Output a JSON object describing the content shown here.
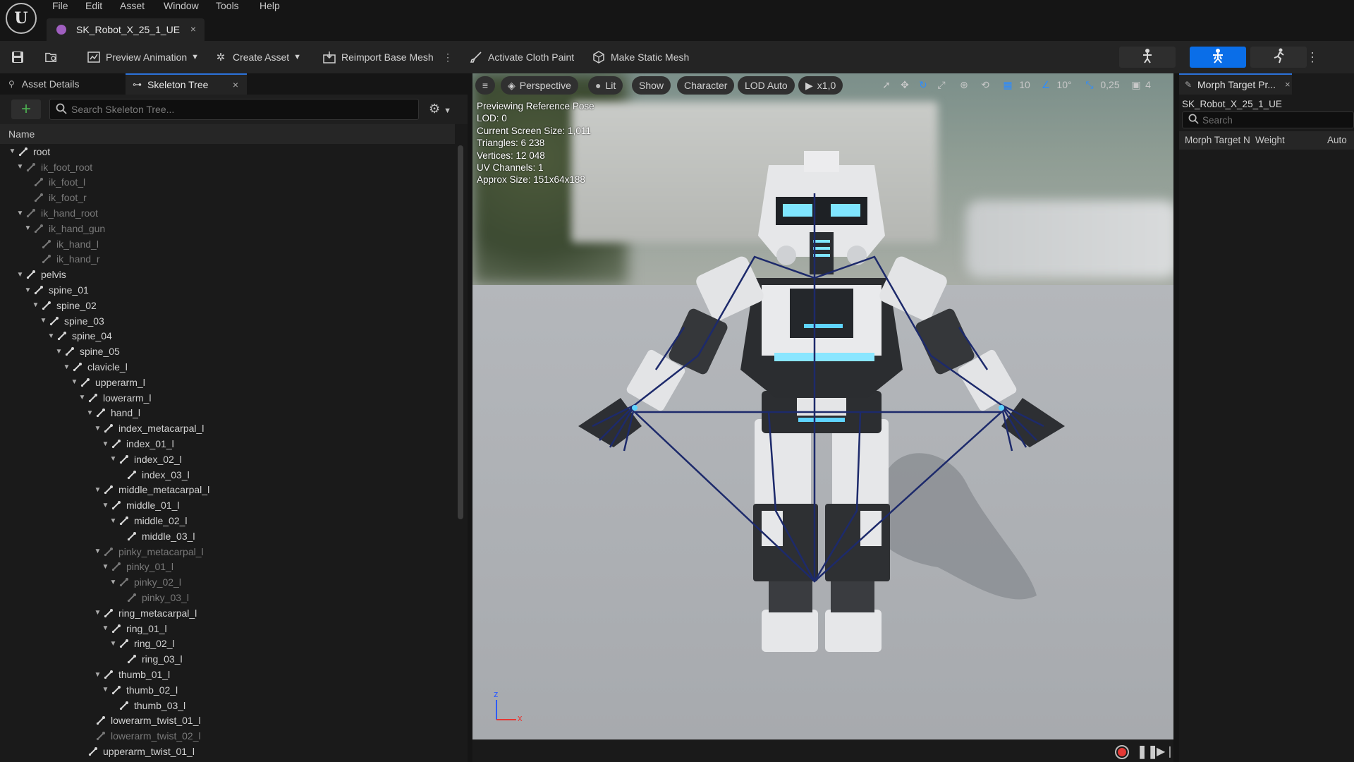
{
  "menu": {
    "items": [
      "File",
      "Edit",
      "Asset",
      "Window",
      "Tools",
      "Help"
    ]
  },
  "document_tab": {
    "title": "SK_Robot_X_25_1_UE",
    "close": "×"
  },
  "toolbar": {
    "preview_animation": "Preview Animation",
    "create_asset": "Create Asset",
    "reimport_base_mesh": "Reimport Base Mesh",
    "activate_cloth_paint": "Activate Cloth Paint",
    "make_static_mesh": "Make Static Mesh"
  },
  "left_panel": {
    "tabs": {
      "asset_details": "Asset Details",
      "skeleton_tree": "Skeleton Tree",
      "close": "×"
    },
    "search_placeholder": "Search Skeleton Tree...",
    "column_header": "Name",
    "bones": [
      {
        "name": "root",
        "depth": 0,
        "dim": false,
        "expanded": true
      },
      {
        "name": "ik_foot_root",
        "depth": 1,
        "dim": true,
        "expanded": true
      },
      {
        "name": "ik_foot_l",
        "depth": 2,
        "dim": true,
        "expanded": null
      },
      {
        "name": "ik_foot_r",
        "depth": 2,
        "dim": true,
        "expanded": null
      },
      {
        "name": "ik_hand_root",
        "depth": 1,
        "dim": true,
        "expanded": true
      },
      {
        "name": "ik_hand_gun",
        "depth": 2,
        "dim": true,
        "expanded": true
      },
      {
        "name": "ik_hand_l",
        "depth": 3,
        "dim": true,
        "expanded": null
      },
      {
        "name": "ik_hand_r",
        "depth": 3,
        "dim": true,
        "expanded": null
      },
      {
        "name": "pelvis",
        "depth": 1,
        "dim": false,
        "expanded": true
      },
      {
        "name": "spine_01",
        "depth": 2,
        "dim": false,
        "expanded": true
      },
      {
        "name": "spine_02",
        "depth": 3,
        "dim": false,
        "expanded": true
      },
      {
        "name": "spine_03",
        "depth": 4,
        "dim": false,
        "expanded": true
      },
      {
        "name": "spine_04",
        "depth": 5,
        "dim": false,
        "expanded": true
      },
      {
        "name": "spine_05",
        "depth": 6,
        "dim": false,
        "expanded": true
      },
      {
        "name": "clavicle_l",
        "depth": 7,
        "dim": false,
        "expanded": true
      },
      {
        "name": "upperarm_l",
        "depth": 8,
        "dim": false,
        "expanded": true
      },
      {
        "name": "lowerarm_l",
        "depth": 9,
        "dim": false,
        "expanded": true
      },
      {
        "name": "hand_l",
        "depth": 10,
        "dim": false,
        "expanded": true
      },
      {
        "name": "index_metacarpal_l",
        "depth": 11,
        "dim": false,
        "expanded": true
      },
      {
        "name": "index_01_l",
        "depth": 12,
        "dim": false,
        "expanded": true
      },
      {
        "name": "index_02_l",
        "depth": 13,
        "dim": false,
        "expanded": true
      },
      {
        "name": "index_03_l",
        "depth": 14,
        "dim": false,
        "expanded": null
      },
      {
        "name": "middle_metacarpal_l",
        "depth": 11,
        "dim": false,
        "expanded": true
      },
      {
        "name": "middle_01_l",
        "depth": 12,
        "dim": false,
        "expanded": true
      },
      {
        "name": "middle_02_l",
        "depth": 13,
        "dim": false,
        "expanded": true
      },
      {
        "name": "middle_03_l",
        "depth": 14,
        "dim": false,
        "expanded": null
      },
      {
        "name": "pinky_metacarpal_l",
        "depth": 11,
        "dim": true,
        "expanded": true
      },
      {
        "name": "pinky_01_l",
        "depth": 12,
        "dim": true,
        "expanded": true
      },
      {
        "name": "pinky_02_l",
        "depth": 13,
        "dim": true,
        "expanded": true
      },
      {
        "name": "pinky_03_l",
        "depth": 14,
        "dim": true,
        "expanded": null
      },
      {
        "name": "ring_metacarpal_l",
        "depth": 11,
        "dim": false,
        "expanded": true
      },
      {
        "name": "ring_01_l",
        "depth": 12,
        "dim": false,
        "expanded": true
      },
      {
        "name": "ring_02_l",
        "depth": 13,
        "dim": false,
        "expanded": true
      },
      {
        "name": "ring_03_l",
        "depth": 14,
        "dim": false,
        "expanded": null
      },
      {
        "name": "thumb_01_l",
        "depth": 11,
        "dim": false,
        "expanded": true
      },
      {
        "name": "thumb_02_l",
        "depth": 12,
        "dim": false,
        "expanded": true
      },
      {
        "name": "thumb_03_l",
        "depth": 13,
        "dim": false,
        "expanded": null
      },
      {
        "name": "lowerarm_twist_01_l",
        "depth": 10,
        "dim": false,
        "expanded": null
      },
      {
        "name": "lowerarm_twist_02_l",
        "depth": 10,
        "dim": true,
        "expanded": null
      },
      {
        "name": "upperarm_twist_01_l",
        "depth": 9,
        "dim": false,
        "expanded": null
      }
    ]
  },
  "viewport": {
    "toolbar": {
      "perspective": "Perspective",
      "lit": "Lit",
      "show": "Show",
      "character": "Character",
      "lod": "LOD Auto",
      "play_speed": "x1,0",
      "grid_snap": "10",
      "rotation_snap": "10°",
      "scale_snap": "0,25",
      "camera_speed": "4"
    },
    "info": [
      "Previewing Reference Pose",
      "LOD: 0",
      "Current Screen Size: 1,011",
      "Triangles: 6 238",
      "Vertices: 12 048",
      "UV Channels: 1",
      "Approx Size: 151x64x188"
    ],
    "axis": {
      "z": "z",
      "x": "x"
    }
  },
  "right_panel": {
    "tab_title": "Morph Target Pr...",
    "close": "×",
    "asset_name": "SK_Robot_X_25_1_UE",
    "search_placeholder": "Search",
    "columns": {
      "morph_target": "Morph Target N",
      "weight": "Weight",
      "auto": "Auto"
    }
  },
  "colors": {
    "accent": "#2b72d9",
    "active_mode": "#0a6ee8",
    "record": "#e53935"
  }
}
